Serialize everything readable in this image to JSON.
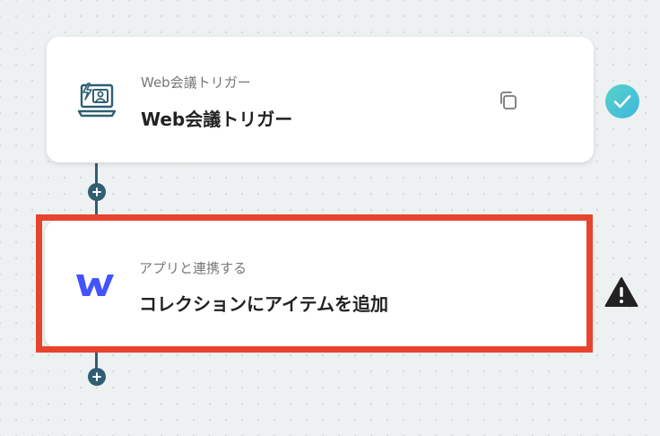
{
  "flow": {
    "steps": [
      {
        "subtitle": "Web会議トリガー",
        "title": "Web会議トリガー",
        "icon": "web-meeting-icon",
        "status": "success-check-icon"
      },
      {
        "subtitle": "アプリと連携する",
        "title": "コレクションにアイテムを追加",
        "icon": "webflow-icon",
        "status": "warning-icon"
      }
    ]
  },
  "colors": {
    "connector": "#2f5e72",
    "success": "#4ec8d0",
    "warning": "#222222",
    "highlight": "#e8432d",
    "webflow": "#4353ff"
  }
}
